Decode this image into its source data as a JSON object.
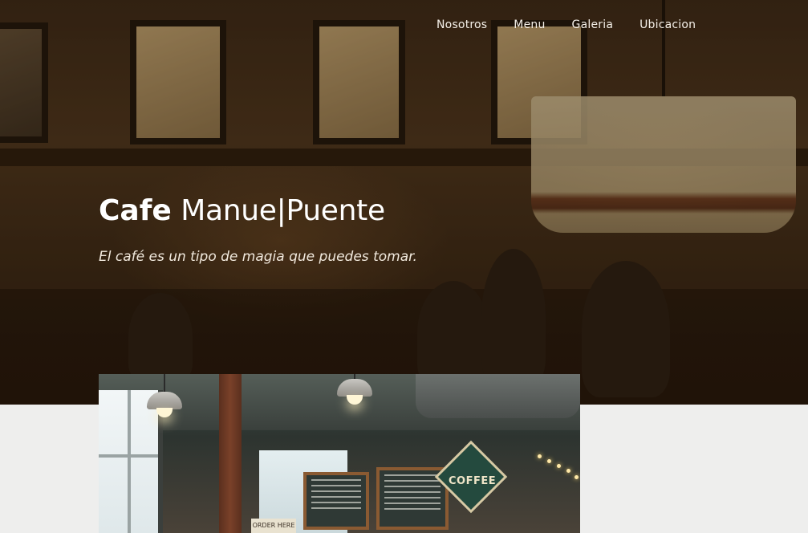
{
  "nav": {
    "items": [
      {
        "label": "Nosotros"
      },
      {
        "label": "Menu"
      },
      {
        "label": "Galeria"
      },
      {
        "label": "Ubicacion"
      }
    ]
  },
  "hero": {
    "brand_strong": "Cafe",
    "brand_light": "Manue|Puente",
    "tagline": "El café es un tipo de magia que puedes tomar."
  },
  "feature": {
    "sign_text": "COFFEE",
    "order_text": "ORDER HERE"
  },
  "colors": {
    "hero_overlay": "#3a2716",
    "nav_text": "#f4efe8",
    "page_background": "#eeeeed"
  }
}
